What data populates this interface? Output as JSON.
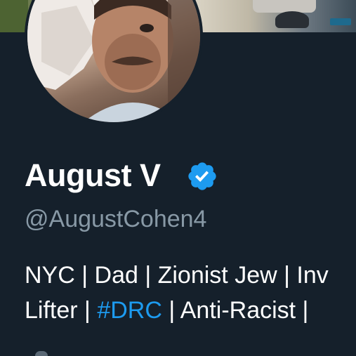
{
  "profile": {
    "display_name": "August V",
    "handle": "@AugustCohen4",
    "verified": true,
    "bio": {
      "line1": "NYC | Dad | Zionist Jew | Inv",
      "line2_before": "Lifter | ",
      "line2_hashtag": "#DRC",
      "line2_after": " | Anti-Racist |"
    }
  },
  "colors": {
    "background": "#15202b",
    "text_primary": "#ffffff",
    "text_secondary": "#8899a6",
    "accent": "#1d9bf0"
  },
  "icons": {
    "verified": "verified-badge-icon"
  }
}
